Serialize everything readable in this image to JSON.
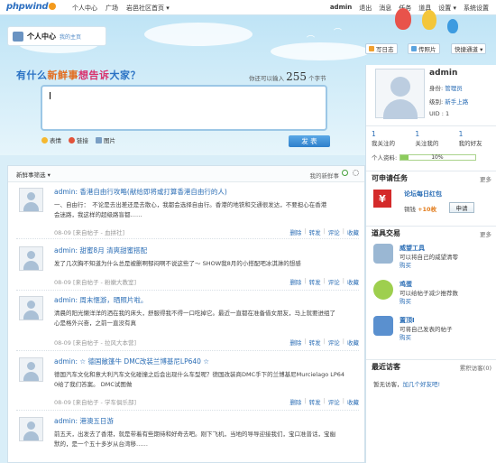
{
  "topbar": {
    "logo": "phpwind",
    "nav_left": [
      "个人中心",
      "广场",
      "岩邑社区首页 ▾"
    ],
    "user": "admin",
    "nav_right": [
      "退出",
      "消息",
      "任务",
      "道具",
      "设置 ▾",
      "系统设置"
    ]
  },
  "page_title": {
    "title": "个人中心",
    "subtitle": "我的主页"
  },
  "toolbar": {
    "write_log": "写日志",
    "upload_photo": "传照片",
    "quick_channel": "快捷通道 ▾"
  },
  "composer": {
    "prompt_parts": [
      "有什么",
      "新鲜事",
      "想告诉",
      "大家？"
    ],
    "counter_prefix": "你还可以输入",
    "counter_value": "255",
    "counter_suffix": "个字节",
    "tools": [
      "表情",
      "链接",
      "图片"
    ],
    "send": "发 表"
  },
  "feed": {
    "filter": "新鲜事筛选 ▾",
    "mine": "我的新鲜事",
    "actions": [
      "删除",
      "转发",
      "评论",
      "收藏"
    ],
    "posts": [
      {
        "author": "admin",
        "title": "香港自由行攻略(献给即将或打算香港自由行的人)",
        "body1": "一、自由行：　不论是去出差还是去散心，我都会选择自由行。香港的地铁和交通很发达，不要担心在香港",
        "body2": "会迷路，我这样的超级路盲都……",
        "meta": "08-09 [来自帖子 - 血拼社]"
      },
      {
        "author": "admin",
        "title": "甜蜜8月  清爽甜蜜搭配",
        "body1": "发了几次胸不知道为什么总是被删啊郁闷啊不说这些了～ SHOW我8月的小搭配吧冰淇淋的想感",
        "body2": "",
        "meta": "08-09 [来自帖子 - 粉嫩大教室]"
      },
      {
        "author": "admin",
        "title": "周末惬游，晒照片啦。",
        "body1": "清晨的阳光懒洋洋的洒在我的床头，舒服得我不得一口吃掉它。最近一直都在准备借女朋友，马上就要进组了",
        "body2": "心是格外兴奋，之前一直没有真",
        "meta": "08-09 [来自帖子 - 拉风大本营]"
      },
      {
        "author": "admin",
        "title": "☆ 德国敞篷牛  DMC改装兰博基尼LP640 ☆",
        "body1": "德国汽车文化和意大利汽车文化碰撞之后会出现什么车型呢？德国改装商DMC手下的兰博基尼Murcielago LP64",
        "body2": "0给了我们答案。 DMC试图做",
        "meta": "08-09 [来自帖子 - 学车俱乐部]"
      },
      {
        "author": "admin",
        "title": "港澳五日游",
        "body1": "前五天，出发去了香港，就是带着有些期待和好奇去吧。刚下飞机，当地的导导迎接我们，宝口准普话，宝幽",
        "body2": "默的，是一个五十多岁从台湾移……",
        "meta": ""
      }
    ]
  },
  "profile": {
    "name": "admin",
    "identity_label": "身份:",
    "identity": "管理员",
    "level_label": "级别:",
    "level": "新手上路",
    "uid": "UID : 1",
    "stats": [
      {
        "count": "1",
        "label": "我关注的"
      },
      {
        "count": "1",
        "label": "关注我的"
      },
      {
        "count": "1",
        "label": "我的好友"
      }
    ],
    "progress_label": "个人资料:",
    "progress_value": 0.1,
    "progress_text": "10%"
  },
  "tasks": {
    "title": "可申请任务",
    "more": "更多",
    "icon_char": "¥",
    "name": "论坛每日红包",
    "reward_prefix": "铜钱",
    "reward": "+10枚",
    "apply": "申请"
  },
  "props": {
    "title": "道具交易",
    "more": "更多",
    "items": [
      {
        "name": "威望工具",
        "desc": "可以将自己的威望清零",
        "buy": "购买",
        "color": "#9ab7d3"
      },
      {
        "name": "鸡蛋",
        "desc": "可以给帖子减少推荐数",
        "buy": "购买",
        "color": "#9ecf4e"
      },
      {
        "name": "置顶I",
        "desc": "可将自己发表的帖子",
        "buy": "购买",
        "color": "#5a90cf"
      }
    ]
  },
  "visitors": {
    "title": "最近访客",
    "more": "累积访客(0)",
    "empty": "暂无访客，",
    "link": "加几个好友吧!"
  }
}
